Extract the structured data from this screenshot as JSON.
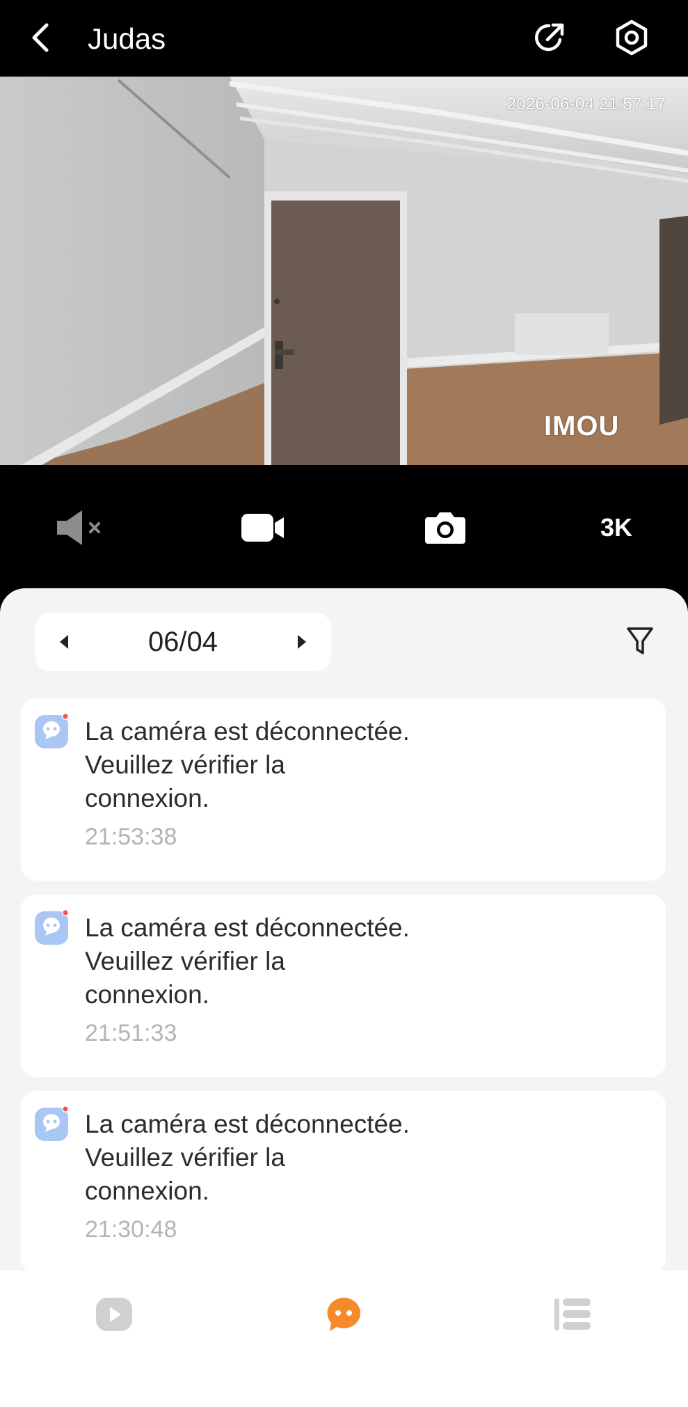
{
  "header": {
    "title": "Judas",
    "icons": {
      "back": "chevron-left-icon",
      "share": "share-icon",
      "settings": "settings-icon"
    }
  },
  "video": {
    "timestamp": "2026-06-04 21:57:17",
    "watermark": "IMOU"
  },
  "controls": {
    "mute_icon": "speaker-muted-icon",
    "record_icon": "video-record-icon",
    "snapshot_icon": "camera-icon",
    "quality_label": "3K"
  },
  "events_panel": {
    "date": "06/04",
    "filter_icon": "filter-icon",
    "events": [
      {
        "message": "La caméra est déconnectée. Veuillez vérifier la connexion.",
        "time": "21:53:38"
      },
      {
        "message": "La caméra est déconnectée. Veuillez vérifier la connexion.",
        "time": "21:51:33"
      },
      {
        "message": "La caméra est déconnectée. Veuillez vérifier la connexion.",
        "time": "21:30:48"
      }
    ]
  },
  "bottom_nav": {
    "items": [
      {
        "icon": "play-icon",
        "active": false
      },
      {
        "icon": "message-icon",
        "active": true
      },
      {
        "icon": "list-icon",
        "active": false
      }
    ],
    "active_color": "#f58a2b",
    "inactive_color": "#d0d0d0"
  },
  "colors": {
    "accent": "#f58a2b",
    "event_icon": "#a9c6f5"
  }
}
